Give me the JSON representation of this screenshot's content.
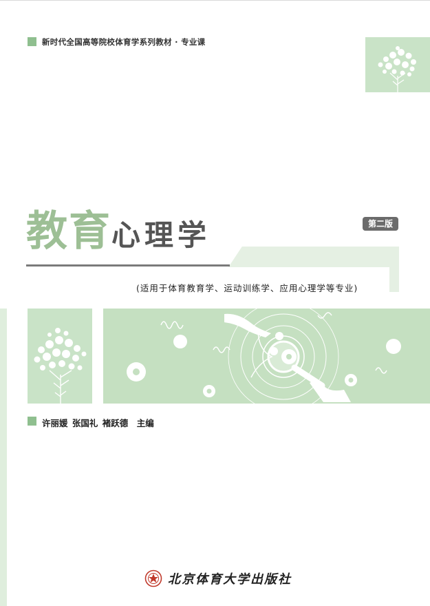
{
  "series": "新时代全国高等院校体育学系列教材 · 专业课",
  "title": {
    "accent": "教育",
    "rest": "心理学"
  },
  "edition": "第二版",
  "subtitle": "(适用于体育教育学、运动训练学、应用心理学等专业)",
  "authors": "许丽媛 张国礼 褚跃德　主编",
  "publisher": "北京体育大学出版社",
  "colors": {
    "accent_green": "#9dbf95",
    "panel_green": "#c5e0c1",
    "light_green": "#e5f0e3",
    "edition_badge": "#6b6b6b"
  },
  "icons": [
    "tree-icon",
    "gear-icon",
    "magnifier-icon",
    "publisher-seal-icon"
  ]
}
